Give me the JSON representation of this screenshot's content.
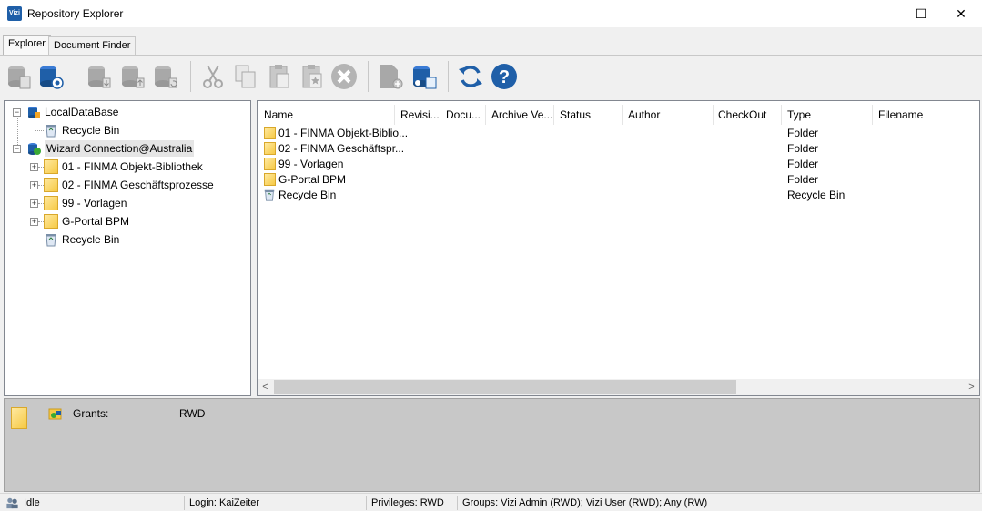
{
  "window": {
    "title": "Repository Explorer",
    "icon_label": "Vizi",
    "minimize_glyph": "—",
    "maximize_glyph": "☐",
    "close_glyph": "✕"
  },
  "tabs": [
    {
      "label": "Explorer",
      "active": true
    },
    {
      "label": "Document Finder",
      "active": false
    }
  ],
  "toolbar": {
    "buttons": [
      {
        "icon": "database-gray-icon",
        "enabled": false
      },
      {
        "icon": "database-connect-icon",
        "enabled": true
      },
      {
        "icon": "database-checkin-icon",
        "enabled": false
      },
      {
        "icon": "database-checkout-icon",
        "enabled": false
      },
      {
        "icon": "database-undo-icon",
        "enabled": false
      },
      {
        "icon": "cut-icon",
        "enabled": false
      },
      {
        "icon": "copy-icon",
        "enabled": false
      },
      {
        "icon": "paste-icon",
        "enabled": false
      },
      {
        "icon": "paste-special-icon",
        "enabled": false
      },
      {
        "icon": "delete-icon",
        "enabled": false
      },
      {
        "icon": "new-document-icon",
        "enabled": false
      },
      {
        "icon": "database-settings-icon",
        "enabled": true
      },
      {
        "icon": "refresh-icon",
        "enabled": true
      },
      {
        "icon": "help-icon",
        "enabled": true
      }
    ]
  },
  "tree": {
    "nodes": [
      {
        "label": "LocalDataBase",
        "icon": "database-icon"
      },
      {
        "label": "Recycle Bin",
        "icon": "recycle-bin-icon"
      },
      {
        "label": "Wizard Connection@Australia",
        "icon": "network-database-icon"
      },
      {
        "label": "01 - FINMA Objekt-Bibliothek",
        "icon": "folder-icon"
      },
      {
        "label": "02 - FINMA Geschäftsprozesse",
        "icon": "folder-icon"
      },
      {
        "label": "99 - Vorlagen",
        "icon": "folder-icon"
      },
      {
        "label": "G-Portal BPM",
        "icon": "folder-icon"
      },
      {
        "label": "Recycle Bin",
        "icon": "recycle-bin-icon"
      }
    ],
    "expander_plus": "+",
    "expander_minus": "−"
  },
  "table": {
    "columns": [
      "Name",
      "Revisi...",
      "Docu...",
      "Archive Ve...",
      "Status",
      "Author",
      "CheckOut",
      "Type",
      "Filename"
    ],
    "rows": [
      {
        "name": "01 - FINMA Objekt-Biblio...",
        "type": "Folder",
        "icon": "folder-icon"
      },
      {
        "name": "02 - FINMA Geschäftspr...",
        "type": "Folder",
        "icon": "folder-icon"
      },
      {
        "name": "99 - Vorlagen",
        "type": "Folder",
        "icon": "folder-icon"
      },
      {
        "name": "G-Portal BPM",
        "type": "Folder",
        "icon": "folder-icon"
      },
      {
        "name": "Recycle Bin",
        "type": "Recycle Bin",
        "icon": "recycle-bin-icon"
      }
    ],
    "scroll_left_glyph": "<",
    "scroll_right_glyph": ">"
  },
  "details": {
    "grants_label": "Grants:",
    "grants_value": "RWD"
  },
  "statusbar": {
    "state": "Idle",
    "login": "Login: KaiZeiter",
    "privileges": "Privileges: RWD",
    "groups": "Groups: Vizi Admin (RWD); Vizi User (RWD); Any (RW)"
  },
  "colors": {
    "accent_blue": "#1f5fa8",
    "folder_yellow": "#f6c944",
    "disabled_gray": "#a8a8a8",
    "details_bg": "#c8c8c8"
  }
}
